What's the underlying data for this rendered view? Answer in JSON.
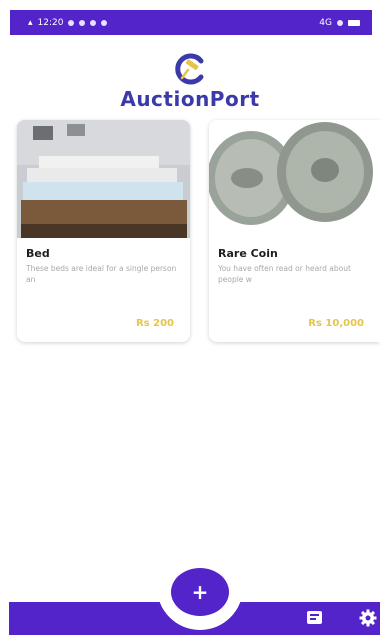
{
  "status_bar": {
    "time": "12:20",
    "network": "4G"
  },
  "app": {
    "name": "AuctionPort",
    "accent_color": "#5324c9",
    "logo_text_color": "#3b3aa8",
    "price_color": "#e6c44c"
  },
  "listings": [
    {
      "title": "Bed",
      "description": "These beds are ideal for a single person an",
      "price": "Rs 200",
      "image": "bed-photo"
    },
    {
      "title": "Rare Coin",
      "description": "You have often read or heard about people w",
      "price": "Rs 10,000",
      "image": "coin-photo"
    }
  ],
  "bottom_nav": {
    "fab_label": "+",
    "icons": [
      "listings-icon",
      "settings-icon"
    ]
  }
}
